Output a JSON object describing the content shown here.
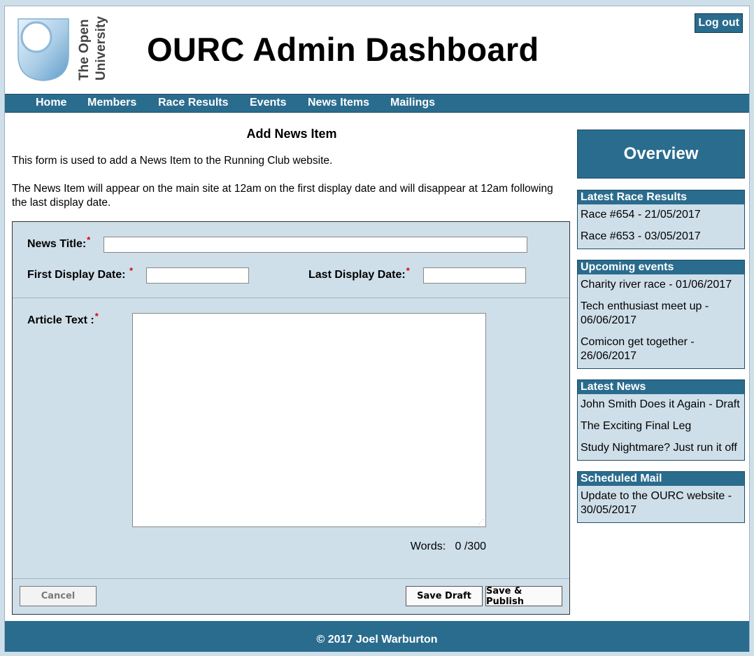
{
  "header": {
    "logo_text": "The Open University",
    "title": "OURC Admin Dashboard",
    "logout_label": "Log out"
  },
  "nav": {
    "items": [
      "Home",
      "Members",
      "Race Results",
      "Events",
      "News Items",
      "Mailings"
    ]
  },
  "form": {
    "heading": "Add News Item",
    "intro_1": "This form is used to add a News Item to the Running Club website.",
    "intro_2": "The News Item will appear on the main site at 12am on the first display date and will disappear at 12am following the last display date.",
    "news_title_label": "News Title:",
    "first_date_label": "First Display Date: ",
    "last_date_label": "Last Display Date:",
    "article_label": "Article Text :",
    "required_mark": "*",
    "words_label": "Words:",
    "words_count": "0 /300",
    "cancel_label": "Cancel",
    "save_draft_label": "Save Draft",
    "save_publish_label": "Save & Publish"
  },
  "sidebar": {
    "overview_title": "Overview",
    "panels": [
      {
        "title": "Latest Race Results",
        "items": [
          "Race #654 - 21/05/2017",
          "Race #653 - 03/05/2017"
        ]
      },
      {
        "title": "Upcoming events",
        "items": [
          "Charity river race - 01/06/2017",
          "Tech enthusiast meet up - 06/06/2017",
          "Comicon get together - 26/06/2017"
        ]
      },
      {
        "title": "Latest News",
        "items": [
          "John Smith Does it Again - Draft",
          "The Exciting Final Leg",
          "Study Nightmare? Just run it off"
        ]
      },
      {
        "title": "Scheduled Mail",
        "items": [
          "Update to the OURC website - 30/05/2017"
        ]
      }
    ]
  },
  "footer": {
    "text": "© 2017 Joel Warburton"
  },
  "colors": {
    "accent": "#2a6c8e",
    "panel_bg": "#cfdfe9",
    "required": "#dd0000"
  }
}
